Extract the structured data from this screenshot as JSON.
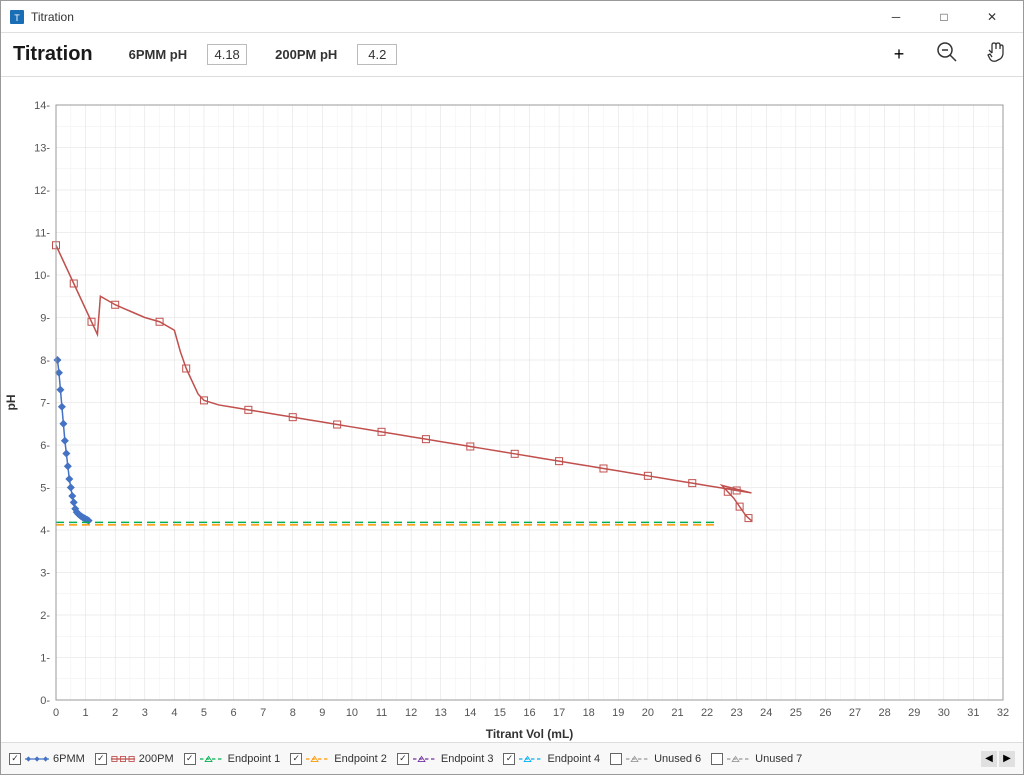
{
  "window": {
    "title": "Titration",
    "minimize_label": "─",
    "maximize_label": "□",
    "close_label": "✕"
  },
  "toolbar": {
    "title": "Titration",
    "ph1_label": "6PMM pH",
    "ph1_value": "4.18",
    "ph2_label": "200PM pH",
    "ph2_value": "4.2",
    "add_icon": "+",
    "zoom_icon": "⊖",
    "hand_icon": "✋"
  },
  "chart": {
    "y_axis_label": "pH",
    "x_axis_label": "Titrant Vol (mL)",
    "y_ticks": [
      "0",
      "1",
      "2",
      "3",
      "4",
      "5",
      "6",
      "7",
      "8",
      "9",
      "10",
      "11",
      "12",
      "13",
      "14"
    ],
    "x_ticks": [
      "0",
      "1",
      "2",
      "3",
      "4",
      "5",
      "6",
      "7",
      "8",
      "9",
      "10",
      "11",
      "12",
      "13",
      "14",
      "15",
      "16",
      "17",
      "18",
      "19",
      "20",
      "21",
      "22",
      "23",
      "24",
      "25",
      "26",
      "27",
      "28",
      "29",
      "30",
      "31",
      "32"
    ]
  },
  "legend": {
    "items": [
      {
        "id": "6pmm",
        "label": "6PMM",
        "checked": true,
        "color": "#4472C4",
        "style": "line-diamond"
      },
      {
        "id": "200pm",
        "label": "200PM",
        "checked": true,
        "color": "#C0504D",
        "style": "line-square"
      },
      {
        "id": "ep1",
        "label": "Endpoint 1",
        "checked": true,
        "color": "#00B050",
        "style": "dashed"
      },
      {
        "id": "ep2",
        "label": "Endpoint 2",
        "checked": true,
        "color": "#FF9900",
        "style": "dashed"
      },
      {
        "id": "ep3",
        "label": "Endpoint 3",
        "checked": true,
        "color": "#7030A0",
        "style": "dashed"
      },
      {
        "id": "ep4",
        "label": "Endpoint 4",
        "checked": true,
        "color": "#00B0F0",
        "style": "dashed"
      },
      {
        "id": "unused6",
        "label": "Unused 6",
        "checked": false,
        "color": "#999",
        "style": "dashed"
      },
      {
        "id": "unused7",
        "label": "Unused 7",
        "checked": false,
        "color": "#999",
        "style": "dashed"
      }
    ]
  }
}
